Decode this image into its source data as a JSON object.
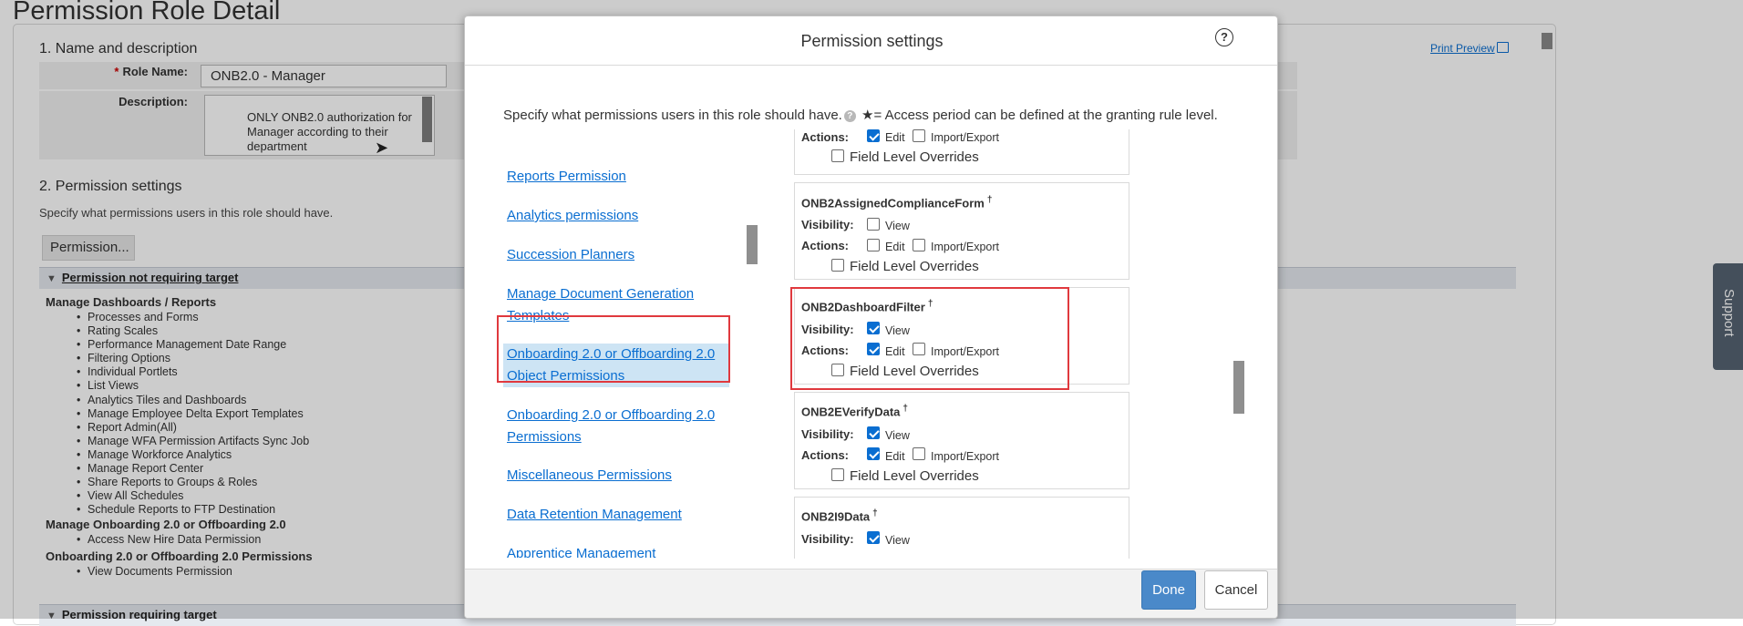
{
  "page": {
    "title": "Permission Role Detail",
    "print_preview": "Print Preview",
    "section1_title": "1. Name and description",
    "role_name_label": "Role Name:",
    "role_name_required": "*",
    "role_name_value": "ONB2.0 - Manager",
    "description_label": "Description:",
    "description_value": "ONLY ONB2.0 authorization for Manager according to their department",
    "section2_title": "2. Permission settings",
    "section2_desc": "Specify what permissions users in this role should have.",
    "permission_button": "Permission...",
    "not_requiring_target": "Permission not requiring target",
    "requiring_target": "Permission requiring target",
    "groups": [
      {
        "title": "Manage Dashboards / Reports",
        "items": [
          "Processes and Forms",
          "Rating Scales",
          "Performance Management Date Range",
          "Filtering Options",
          "Individual Portlets",
          "List Views",
          "Analytics Tiles and Dashboards",
          "Manage Employee Delta Export Templates",
          "Report Admin(All)",
          "Manage WFA Permission Artifacts Sync Job",
          "Manage Workforce Analytics",
          "Manage Report Center",
          "Share Reports to Groups & Roles",
          "View All Schedules",
          "Schedule Reports to FTP Destination"
        ]
      },
      {
        "title": "Manage Onboarding 2.0 or Offboarding 2.0",
        "items": [
          "Access New Hire Data Permission"
        ]
      },
      {
        "title": "Onboarding 2.0 or Offboarding 2.0 Permissions",
        "items": [
          "View Documents Permission"
        ]
      }
    ],
    "support_tab": "Support"
  },
  "modal": {
    "title": "Permission settings",
    "help_icon": "question-circle-icon",
    "intro": "Specify what permissions users in this role should have.",
    "intro_note": "★= Access period can be defined at the granting rule level.",
    "nav_items": [
      "Reports Permission",
      "Analytics permissions",
      "Succession Planners",
      "Manage Document Generation Templates",
      "Onboarding 2.0 or Offboarding 2.0 Object Permissions",
      "Onboarding 2.0 or Offboarding 2.0 Permissions",
      "Miscellaneous Permissions",
      "Data Retention Management",
      "Apprentice Management"
    ],
    "selected_nav": "Onboarding 2.0 or Offboarding 2.0 Object Permissions",
    "labels": {
      "visibility": "Visibility:",
      "actions": "Actions:",
      "view": "View",
      "edit": "Edit",
      "import_export": "Import/Export",
      "field_level_overrides": "Field Level Overrides",
      "dagger": "†"
    },
    "objects": [
      {
        "name": "",
        "view": null,
        "edit": true,
        "import_export": false,
        "flo": false
      },
      {
        "name": "ONB2AssignedComplianceForm",
        "view": false,
        "edit": false,
        "import_export": false,
        "flo": false
      },
      {
        "name": "ONB2DashboardFilter",
        "view": true,
        "edit": true,
        "import_export": false,
        "flo": false
      },
      {
        "name": "ONB2EVerifyData",
        "view": true,
        "edit": true,
        "import_export": false,
        "flo": false
      },
      {
        "name": "ONB2I9Data",
        "view": true,
        "edit": null,
        "import_export": null,
        "flo": null
      }
    ],
    "done_button": "Done",
    "cancel_button": "Cancel",
    "colors": {
      "link": "#0a6ed1",
      "selected_bg": "#cde4f4",
      "highlight": "#e0393e",
      "done_bg": "#4a89c9"
    }
  }
}
